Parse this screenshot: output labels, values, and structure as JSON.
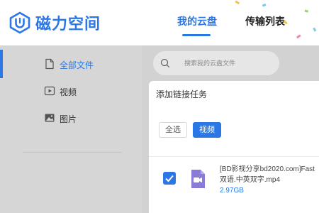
{
  "header": {
    "brand": "磁力空间",
    "tabs": [
      {
        "label": "我的云盘",
        "active": true
      },
      {
        "label": "传输列表",
        "active": false
      }
    ]
  },
  "sidebar": {
    "items": [
      {
        "label": "全部文件",
        "icon": "document-icon",
        "active": true
      },
      {
        "label": "视频",
        "icon": "video-icon",
        "active": false
      },
      {
        "label": "图片",
        "icon": "image-icon",
        "active": false
      }
    ]
  },
  "search": {
    "placeholder": "搜索我的云盘文件"
  },
  "dialog": {
    "title": "添加链接任务",
    "filters": {
      "all": "全选",
      "video": "视频"
    },
    "file": {
      "name_line1": "[BD影视分享bd2020.com]Fast",
      "name_line2": "双语.中英双字.mp4",
      "size": "2.97GB",
      "checked": true
    }
  },
  "colors": {
    "accent": "#2b77e6",
    "overlay": "#d2d2d2",
    "video_file_icon": "#8a7bd8"
  }
}
